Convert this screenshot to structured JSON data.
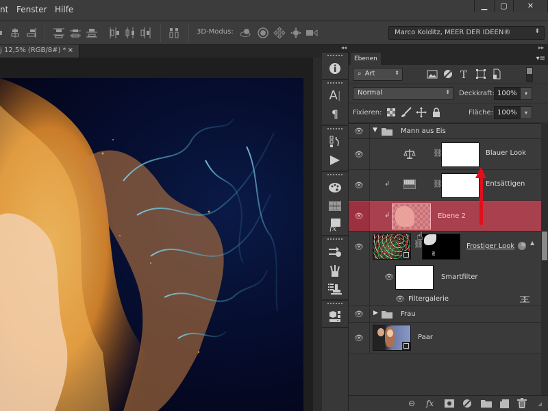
{
  "menubar": {
    "items": [
      "nt",
      "Fenster",
      "Hilfe"
    ],
    "window_controls": {
      "minimize": "▁",
      "maximize": "▢",
      "close": "✕"
    }
  },
  "options_bar": {
    "align_icons": [
      "align-left-icon",
      "align-horizontal-center-icon",
      "align-right-icon",
      "distribute-top-icon",
      "distribute-vertical-center-icon",
      "distribute-bottom-icon",
      "distribute-left-icon",
      "distribute-horizontal-center-icon",
      "distribute-right-icon",
      "auto-align-icon"
    ],
    "mode_label": "3D-Modus:",
    "mode_icons": [
      "3d-orbit-icon",
      "3d-roll-icon",
      "3d-pan-icon",
      "3d-slide-icon",
      "3d-scale-icon"
    ],
    "workspace": "Marco Kolditz, MEER DER IDEEN®"
  },
  "document_tab": {
    "title": "j 12,5% (RGB/8#) *",
    "close": "×"
  },
  "panel_collapse": {
    "left": "◂◂",
    "right": "▸▸"
  },
  "dock_icons": [
    [
      "info-icon"
    ],
    [
      "character-icon",
      "paragraph-icon"
    ],
    [
      "history-icon",
      "actions-icon"
    ],
    [
      "color-palette-icon",
      "swatches-icon",
      "styles-icon"
    ],
    [
      "adjustments-icon",
      "brush-presets-icon",
      "clone-source-icon"
    ],
    [
      "3d-icon"
    ]
  ],
  "layers_panel": {
    "tab": "Ebenen",
    "filter_kind": "Art",
    "blend_mode": "Normal",
    "opacity_label": "Deckkraft:",
    "opacity": "100%",
    "lock_label": "Fixieren:",
    "fill_label": "Fläche:",
    "fill": "100%",
    "layers": [
      {
        "name": "Mann aus Eis",
        "type": "group",
        "expanded": true
      },
      {
        "name": "Blauer Look",
        "type": "adjustment-color-balance"
      },
      {
        "name": "Entsättigen",
        "type": "adjustment-gradient-map",
        "clipped": true
      },
      {
        "name": "Ebene 2",
        "type": "pixel",
        "clipped": true,
        "selected": true
      },
      {
        "name": "Frostiger Look",
        "type": "smart-object"
      },
      {
        "name": "Smartfilter",
        "type": "smart-filter-mask"
      },
      {
        "name": "Filtergalerie",
        "type": "filter"
      },
      {
        "name": "Frau",
        "type": "group",
        "expanded": false
      },
      {
        "name": "Paar",
        "type": "smart-object"
      }
    ],
    "bottom_icons": [
      "link-layers-icon",
      "fx-icon",
      "add-mask-icon",
      "adjustment-layer-icon",
      "new-group-icon",
      "new-layer-icon",
      "delete-icon"
    ]
  },
  "colors": {
    "selected_layer": "#a8404e",
    "annotation_arrow": "#e0101a",
    "panel_bg": "#383838"
  }
}
